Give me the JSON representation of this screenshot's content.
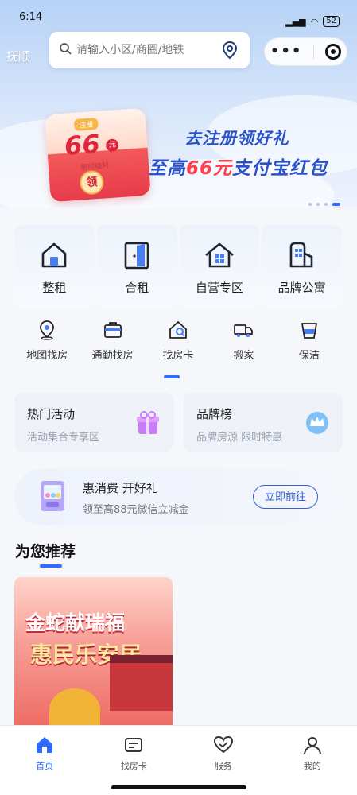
{
  "status_bar": {
    "time": "6:14",
    "battery": "52"
  },
  "header": {
    "city": "抚顺",
    "search_placeholder": "请输入小区/商圈/地铁"
  },
  "banner": {
    "packet_tag": "注册",
    "packet_amount": "66",
    "packet_unit": "元",
    "packet_limit": "限时福利",
    "packet_button": "领",
    "line1": "去注册领好礼",
    "line2_prefix": "至高",
    "line2_highlight": "66元",
    "line2_suffix": "支付宝红包"
  },
  "categories": [
    {
      "label": "整租",
      "icon": "house-icon"
    },
    {
      "label": "合租",
      "icon": "door-icon"
    },
    {
      "label": "自营专区",
      "icon": "home-grid-icon"
    },
    {
      "label": "品牌公寓",
      "icon": "building-icon"
    }
  ],
  "sub_services": [
    {
      "label": "地图找房",
      "icon": "map-pin-icon"
    },
    {
      "label": "通勤找房",
      "icon": "briefcase-icon"
    },
    {
      "label": "找房卡",
      "icon": "house-search-icon"
    },
    {
      "label": "搬家",
      "icon": "truck-icon"
    },
    {
      "label": "保洁",
      "icon": "bucket-icon"
    }
  ],
  "activities": [
    {
      "title": "热门活动",
      "subtitle": "活动集合专享区"
    },
    {
      "title": "品牌榜",
      "subtitle": "品牌房源 限时特惠"
    }
  ],
  "coupon": {
    "title": "惠消费 开好礼",
    "subtitle": "领至高88元微信立减金",
    "button": "立即前往"
  },
  "recommend": {
    "title": "为您推荐",
    "card_line1": "金蛇献瑞福",
    "card_line2": "惠民乐安居"
  },
  "tabbar": [
    {
      "label": "首页",
      "active": true
    },
    {
      "label": "找房卡",
      "active": false
    },
    {
      "label": "服务",
      "active": false
    },
    {
      "label": "我的",
      "active": false
    }
  ],
  "colors": {
    "accent": "#2f6bff",
    "promo_blue": "#2b52c8",
    "promo_red": "#ff3f4a"
  }
}
